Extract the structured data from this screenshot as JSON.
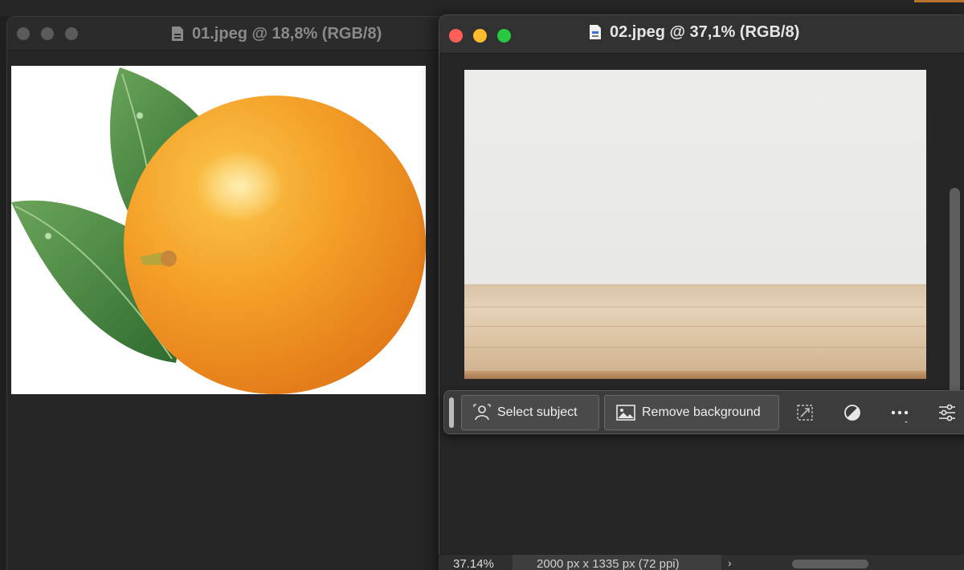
{
  "windows": {
    "first": {
      "title": "01.jpeg @ 18,8% (RGB/8)"
    },
    "second": {
      "title": "02.jpeg @ 37,1% (RGB/8)"
    }
  },
  "taskbar": {
    "select_subject_label": "Select subject",
    "remove_background_label": "Remove background"
  },
  "statusbar": {
    "zoom": "37.14%",
    "doc_info": "2000 px x 1335 px (72 ppi)",
    "chevron": "›"
  },
  "colors": {
    "background": "#1e1e1e",
    "close": "#ff5f57",
    "minimize": "#febc2e",
    "zoom": "#28c840"
  }
}
